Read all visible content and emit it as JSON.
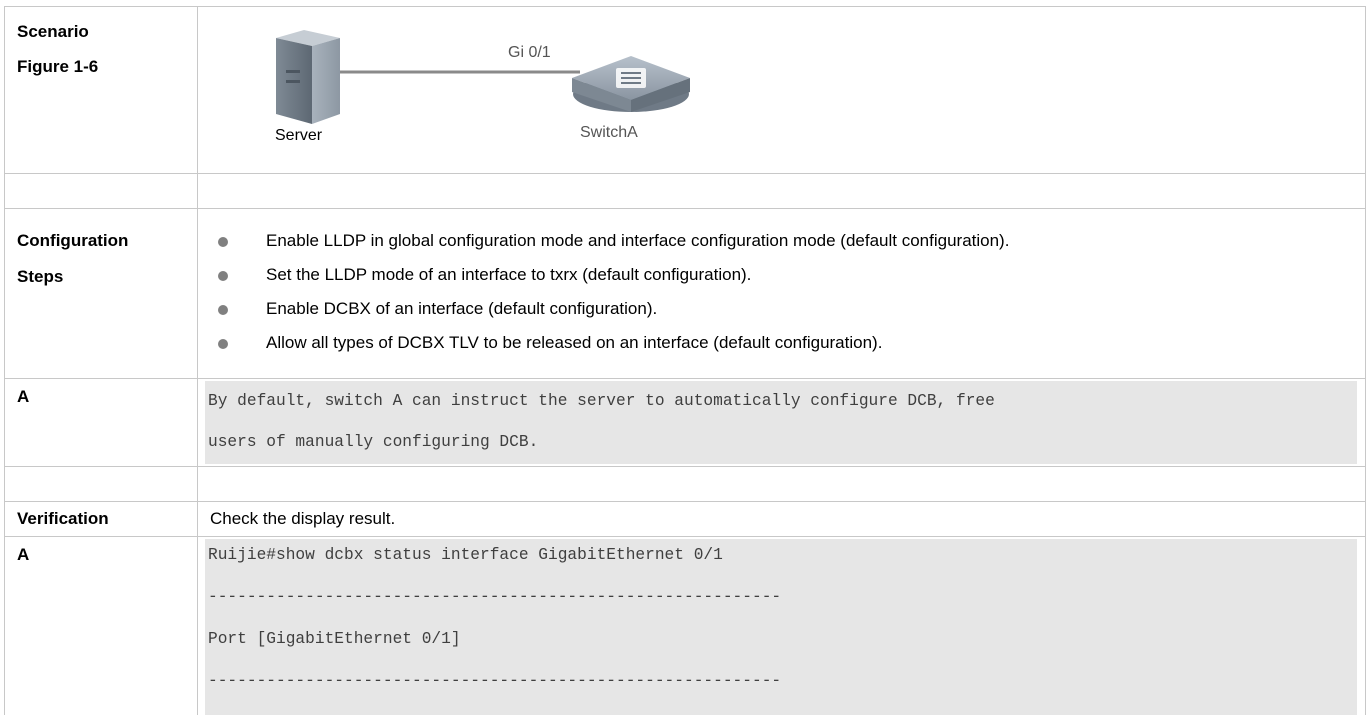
{
  "scenario": {
    "label_line1": "Scenario",
    "label_line2": "Figure 1-6",
    "diagram": {
      "server_label": "Server",
      "port_label": "Gi 0/1",
      "switch_label": "SwitchA"
    }
  },
  "configuration": {
    "label_line1": "Configuration",
    "label_line2": "Steps",
    "steps": [
      "Enable LLDP in global configuration mode and interface configuration mode (default configuration).",
      "Set the LLDP mode of an interface to txrx (default configuration).",
      "Enable DCBX of an interface (default configuration).",
      "Allow all types of DCBX TLV to be released on an interface (default configuration)."
    ]
  },
  "config_code": {
    "label": "A",
    "lines": [
      "By default, switch A can instruct the server to automatically configure DCB, free",
      "users of manually configuring DCB."
    ]
  },
  "verification": {
    "label": "Verification",
    "text": "Check the display result."
  },
  "verify_code": {
    "label": "A",
    "lines": [
      "Ruijie#show dcbx status interface GigabitEthernet 0/1",
      "-----------------------------------------------------------",
      "Port [GigabitEthernet 0/1]",
      "-----------------------------------------------------------"
    ]
  },
  "colors": {
    "grid": "#c8c8c8",
    "code_bg": "#e6e6e6",
    "code_text": "#3f3f3f",
    "bullet": "#808080"
  }
}
